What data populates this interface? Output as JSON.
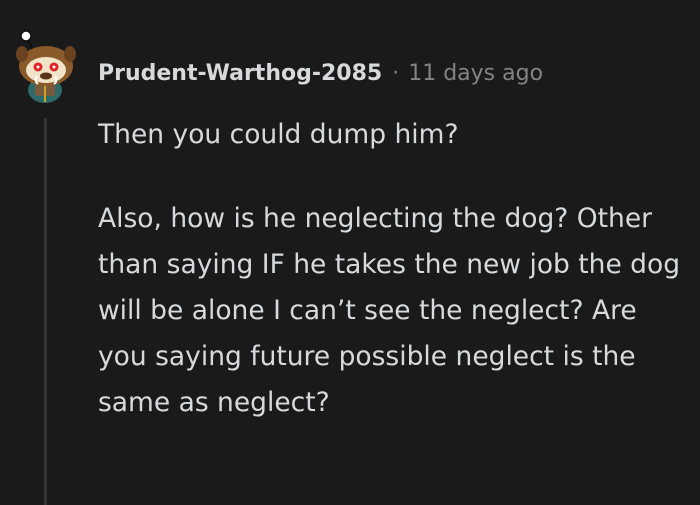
{
  "comment": {
    "author": "Prudent-Warthog-2085",
    "separator": "·",
    "timestamp": "11 days ago",
    "paragraphs": [
      "Then you could dump him?",
      "Also, how is he neglecting the dog? Other than saying IF he takes the new job the dog will be alone I can’t see the neglect? Are you saying future possible neglect is the same as neglect?"
    ],
    "avatar_icon": "snoo-avatar-icon"
  },
  "colors": {
    "background": "#1a1a1b",
    "text": "#d7dadc",
    "meta": "#818384",
    "thread_line": "#343536"
  }
}
